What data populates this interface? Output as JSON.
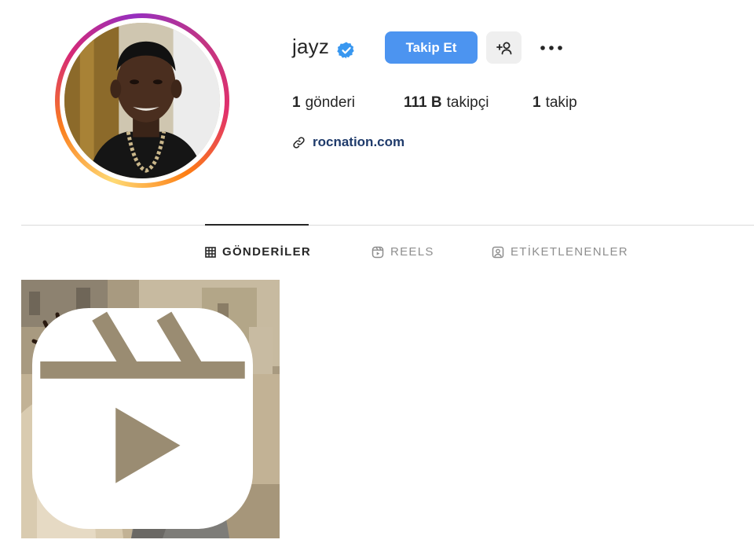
{
  "profile": {
    "username": "jayz",
    "verified": true,
    "follow_label": "Takip Et",
    "add_user_icon": "person-add-icon",
    "more_icon": "more-options-icon",
    "link": "rocnation.com",
    "link_icon": "link-icon"
  },
  "stats": {
    "posts_value": "1",
    "posts_label": "gönderi",
    "followers_value": "111 B",
    "followers_label": "takipçi",
    "following_value": "1",
    "following_label": "takip"
  },
  "tabs": [
    {
      "label": "GÖNDERİLER",
      "icon": "grid-icon",
      "active": true
    },
    {
      "label": "REELS",
      "icon": "reels-icon",
      "active": false
    },
    {
      "label": "ETİKETLENENLER",
      "icon": "tagged-icon",
      "active": false
    }
  ],
  "posts": [
    {
      "type": "reel",
      "badge_icon": "reel-badge-icon"
    }
  ],
  "colors": {
    "follow_button": "#4c94f0",
    "verified_badge": "#3897f0",
    "link_text": "#1f3b6b",
    "inactive_tab": "#8e8e8e"
  }
}
